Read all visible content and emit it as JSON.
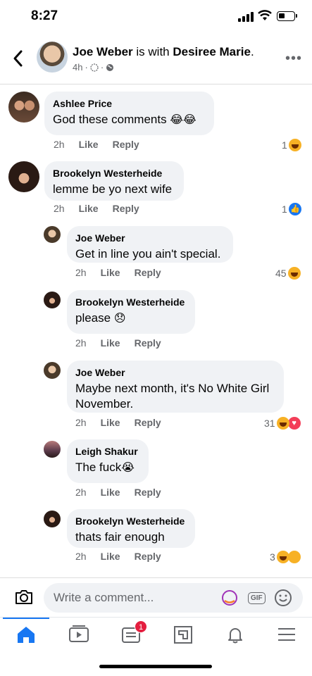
{
  "status": {
    "time": "8:27"
  },
  "post_header": {
    "author": "Joe Weber",
    "with_text": " is with ",
    "tagged": "Desiree Marie",
    "period": ".",
    "age": "4h",
    "sep": "·",
    "sep2": "·"
  },
  "comments": [
    {
      "name": "Ashlee Price",
      "text": "God these comments",
      "emoji": "😂😂",
      "time": "2h",
      "like": "Like",
      "reply": "Reply",
      "react_count": "1",
      "react_type": "haha"
    },
    {
      "name": "Brookelyn Westerheide",
      "text": "lemme be yo next wife",
      "time": "2h",
      "like": "Like",
      "reply": "Reply",
      "react_count": "1",
      "react_type": "like"
    },
    {
      "name": "Joe Weber",
      "text": "Get in line you ain't special.",
      "time": "2h",
      "like": "Like",
      "reply": "Reply",
      "react_count": "45",
      "react_type": "haha"
    },
    {
      "name": "Brookelyn Westerheide",
      "text": "please",
      "emoji": "😞",
      "time": "2h",
      "like": "Like",
      "reply": "Reply"
    },
    {
      "name": "Joe Weber",
      "text": "Maybe next month, it's No White Girl November.",
      "time": "2h",
      "like": "Like",
      "reply": "Reply",
      "react_count": "31",
      "react_type": "haha+love"
    },
    {
      "name": "Leigh Shakur",
      "text": "The fuck",
      "emoji": "😭",
      "time": "2h",
      "like": "Like",
      "reply": "Reply"
    },
    {
      "name": "Brookelyn Westerheide",
      "text": "thats fair enough",
      "time": "2h",
      "like": "Like",
      "reply": "Reply",
      "react_count": "3",
      "react_type": "haha+sad"
    }
  ],
  "composer": {
    "placeholder": "Write a comment...",
    "gif_label": "GIF"
  },
  "tabbar": {
    "notification_badge": "1"
  },
  "colors": {
    "accent": "#1877f2",
    "bubble": "#f0f2f5",
    "secondary_text": "#65676b",
    "badge": "#e41e3f"
  }
}
